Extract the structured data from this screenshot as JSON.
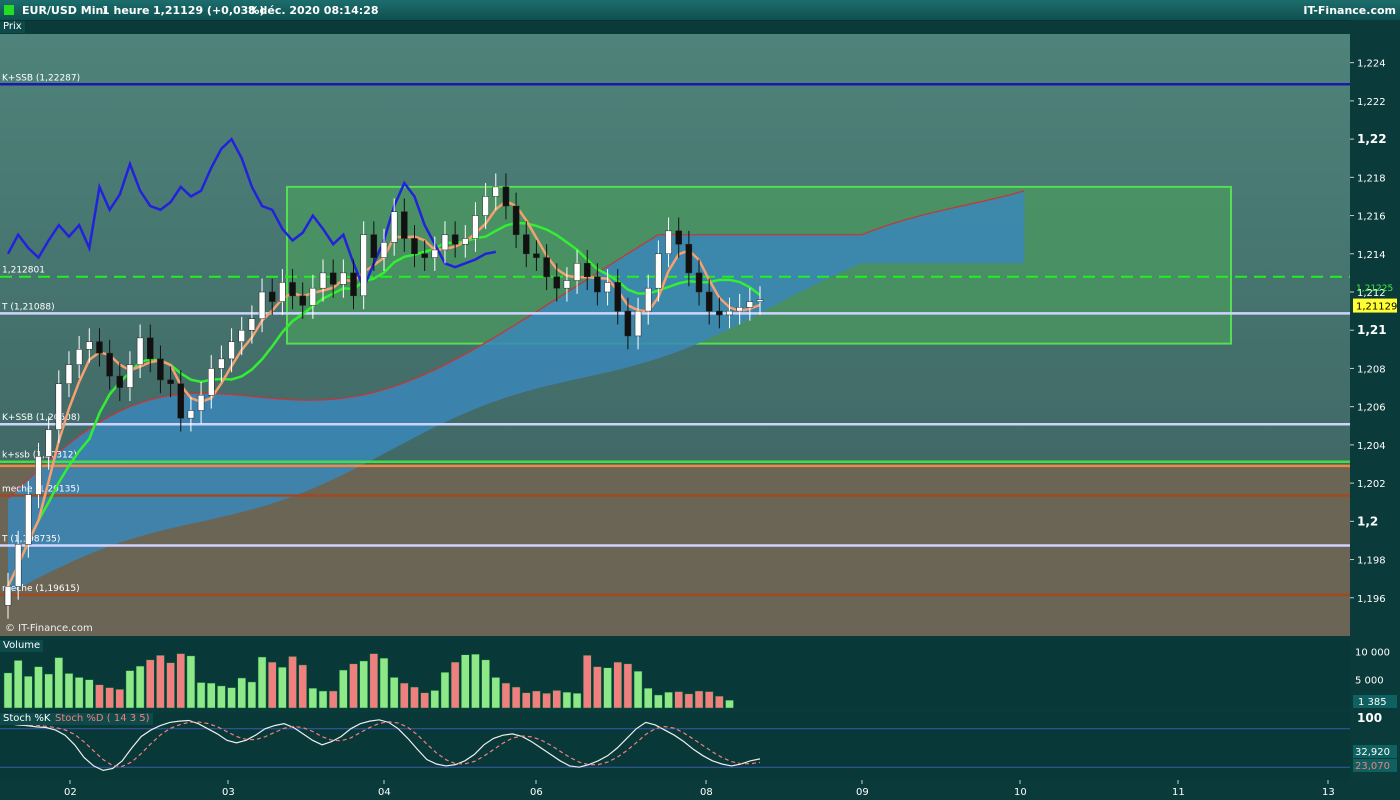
{
  "header": {
    "title": "EUR/USD Mini",
    "period": "1 heure",
    "quote": "1,21129 (+0,03%)",
    "datetime": "8 déc. 2020 08:14:28",
    "brand": "IT-Finance.com"
  },
  "panels": {
    "price": "Prix",
    "volume": "Volume",
    "stoch_k": "Stoch %K",
    "stoch_d": "Stoch %D ( 14 3 5)",
    "watermark": "© IT-Finance.com"
  },
  "colors": {
    "bg_top": "#4c8178",
    "bg_bottom": "#3a5e5e",
    "zone_low": "#6b6556",
    "kijun": "#33ee33",
    "tenkan": "#f4a070",
    "chikou": "#2222dd",
    "cloud": "#3a87b8",
    "cloud_edge": "#cc3333",
    "vol_up": "#8ee888",
    "vol_down": "#f08080"
  },
  "chart_data": [
    {
      "type": "line",
      "title": "EUR/USD Mini",
      "ylim": [
        1.194,
        1.2255
      ],
      "y_ticks": [
        "1,196",
        "1,198",
        "1,2",
        "1,202",
        "1,204",
        "1,206",
        "1,208",
        "1,21",
        "1,212",
        "1,214",
        "1,216",
        "1,218",
        "1,22",
        "1,222",
        "1,224"
      ],
      "x_ticks": [
        "02",
        "03",
        "04",
        "06",
        "08",
        "09",
        "10",
        "11",
        "13"
      ],
      "current_price_label": "1,21129",
      "secondary_price_label": "1,21225",
      "horizontal_lines": [
        {
          "label": "K+SSB (1,22287)",
          "value": 1.22287,
          "color": "#1a1aa8"
        },
        {
          "label": "1,212801",
          "value": 1.212801,
          "color": "#22ee22",
          "dashed": true
        },
        {
          "label": "T (1,21088)",
          "value": 1.21088,
          "color": "#cfd4ff"
        },
        {
          "label": "K+SSB (1,20508)",
          "value": 1.20508,
          "color": "#cfd4ff"
        },
        {
          "label": "k+ssb (1,20312)",
          "value": 1.20312,
          "color": "#44dd44"
        },
        {
          "label": "",
          "value": 1.2029,
          "color": "#f08a40"
        },
        {
          "label": "meche (1,20135)",
          "value": 1.20135,
          "color": "#a04a20"
        },
        {
          "label": "T (1,198735)",
          "value": 1.198735,
          "color": "#cfd4ff"
        },
        {
          "label": "meche (1,19615)",
          "value": 1.19615,
          "color": "#a04a20"
        }
      ],
      "zone_rectangle": {
        "y_top": 1.2175,
        "y_bottom": 1.2093
      },
      "candles_close": [
        1.1966,
        1.1988,
        1.2014,
        1.2034,
        1.2048,
        1.2072,
        1.2082,
        1.209,
        1.2094,
        1.2088,
        1.2076,
        1.207,
        1.2082,
        1.2096,
        1.2085,
        1.2074,
        1.2072,
        1.2054,
        1.2058,
        1.2066,
        1.208,
        1.2085,
        1.2094,
        1.21,
        1.2106,
        1.212,
        1.2115,
        1.2125,
        1.2118,
        1.2113,
        1.2122,
        1.213,
        1.2124,
        1.213,
        1.2118,
        1.215,
        1.2138,
        1.2146,
        1.2162,
        1.2148,
        1.214,
        1.2138,
        1.2142,
        1.215,
        1.2145,
        1.2148,
        1.216,
        1.217,
        1.2175,
        1.2165,
        1.215,
        1.214,
        1.2138,
        1.2128,
        1.2122,
        1.2126,
        1.2135,
        1.2128,
        1.212,
        1.2125,
        1.211,
        1.2097,
        1.211,
        1.2122,
        1.214,
        1.2152,
        1.2145,
        1.213,
        1.212,
        1.211,
        1.2108,
        1.211,
        1.2112,
        1.2115,
        1.2116
      ],
      "volume": {
        "ticks": [
          "10 000",
          "5 000"
        ],
        "last_label": "1 385",
        "values": [
          6200,
          8400,
          5600,
          7300,
          6000,
          8900,
          6100,
          5400,
          5000,
          4100,
          3600,
          3300,
          6600,
          7400,
          8500,
          9300,
          8000,
          9600,
          9200,
          4500,
          4400,
          3900,
          3600,
          5300,
          4600,
          9000,
          8100,
          7200,
          9100,
          7600,
          3500,
          3000,
          3000,
          6700,
          7800,
          8300,
          9600,
          8800,
          5400,
          4400,
          3700,
          2700,
          3100,
          6300,
          8100,
          9400,
          9500,
          8500,
          5400,
          4400,
          3700,
          2700,
          3000,
          2600,
          3100,
          2800,
          2600,
          9300,
          7300,
          7100,
          8100,
          7800,
          6500,
          3500,
          2300,
          2800,
          2900,
          2500,
          3000,
          2900,
          2100,
          1385
        ]
      },
      "stochastic": {
        "ylim": [
          0,
          100
        ],
        "tick": "100",
        "k_label": "32,920",
        "d_label": "23,070",
        "levels": [
          80,
          20
        ],
        "k": [
          88,
          86,
          85,
          83,
          82,
          78,
          70,
          55,
          35,
          22,
          15,
          18,
          30,
          50,
          68,
          78,
          85,
          90,
          92,
          93,
          88,
          80,
          72,
          62,
          58,
          62,
          70,
          80,
          85,
          88,
          82,
          72,
          62,
          55,
          60,
          68,
          80,
          88,
          92,
          94,
          90,
          80,
          65,
          48,
          32,
          25,
          22,
          24,
          30,
          40,
          55,
          65,
          70,
          72,
          68,
          60,
          50,
          40,
          30,
          22,
          20,
          24,
          30,
          38,
          50,
          65,
          80,
          90,
          86,
          78,
          70,
          60,
          48,
          38,
          30,
          25,
          22,
          25,
          30,
          33
        ]
      }
    }
  ]
}
